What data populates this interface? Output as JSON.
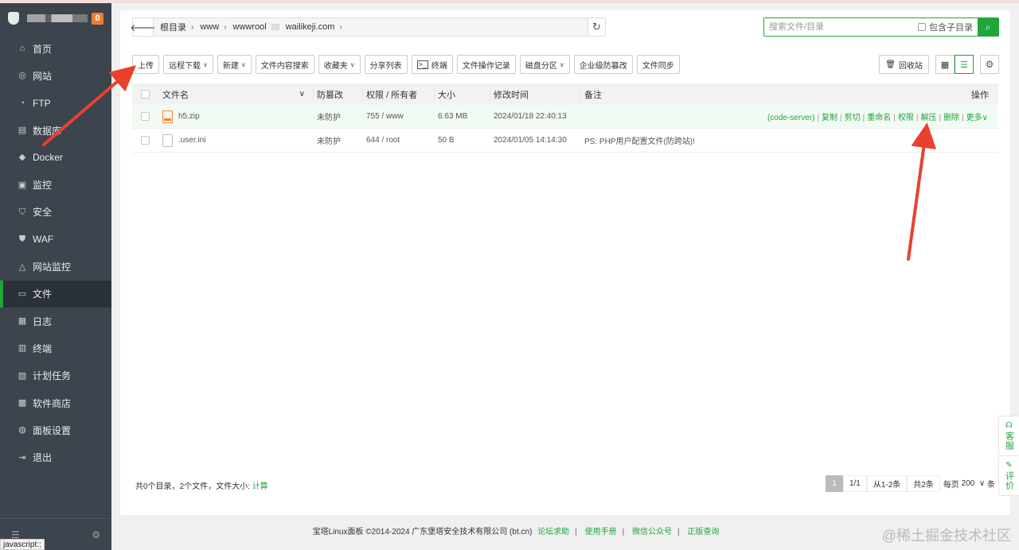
{
  "sidebar": {
    "badge": "0",
    "items": [
      {
        "label": "首页",
        "icon": "home-icon",
        "glyph": "⌂"
      },
      {
        "label": "网站",
        "icon": "globe-icon",
        "glyph": "◎"
      },
      {
        "label": "FTP",
        "icon": "ftp-icon",
        "glyph": "◔"
      },
      {
        "label": "数据库",
        "icon": "database-icon",
        "glyph": "▤"
      },
      {
        "label": "Docker",
        "icon": "docker-icon",
        "glyph": "◆"
      },
      {
        "label": "监控",
        "icon": "monitor-icon",
        "glyph": "▣"
      },
      {
        "label": "安全",
        "icon": "shield-icon",
        "glyph": "⛉"
      },
      {
        "label": "WAF",
        "icon": "waf-icon",
        "glyph": "⛊"
      },
      {
        "label": "网站监控",
        "icon": "chart-icon",
        "glyph": "△"
      },
      {
        "label": "文件",
        "icon": "folder-icon",
        "glyph": "▭"
      },
      {
        "label": "日志",
        "icon": "log-icon",
        "glyph": "▦"
      },
      {
        "label": "终端",
        "icon": "terminal-icon",
        "glyph": "▥"
      },
      {
        "label": "计划任务",
        "icon": "task-icon",
        "glyph": "▧"
      },
      {
        "label": "软件商店",
        "icon": "store-icon",
        "glyph": "▩"
      },
      {
        "label": "面板设置",
        "icon": "settings-icon",
        "glyph": "◍"
      },
      {
        "label": "退出",
        "icon": "logout-icon",
        "glyph": "⇥"
      }
    ],
    "active_index": 9,
    "status_tip": "javascript:;"
  },
  "path": {
    "crumbs": [
      "根目录",
      "www",
      "wwwrool",
      "wailikeji.com"
    ]
  },
  "search": {
    "placeholder": "搜索文件/目录",
    "include_sub": "包含子目录"
  },
  "toolbar": {
    "upload": "上传",
    "remote_download": "远程下载",
    "new": "新建",
    "content_search": "文件内容搜索",
    "favorites": "收藏夹",
    "share_list": "分享列表",
    "terminal": "终端",
    "op_log": "文件操作记录",
    "disk": "磁盘分区",
    "tamper": "企业级防篡改",
    "sync": "文件同步",
    "recycle": "回收站"
  },
  "table": {
    "headers": {
      "name": "文件名",
      "protect": "防篡改",
      "perm": "权限 / 所有者",
      "size": "大小",
      "mtime": "修改时间",
      "note": "备注",
      "ops": "操作"
    },
    "rows": [
      {
        "name": "h5.zip",
        "type": "zip",
        "protect": "未防护",
        "perm": "755 / www",
        "size": "6.63 MB",
        "mtime": "2024/01/18 22:40:13",
        "note": ""
      },
      {
        "name": ".user.ini",
        "type": "file",
        "protect": "未防护",
        "perm": "644 / root",
        "size": "50 B",
        "mtime": "2024/01/05 14:14:30",
        "note": "PS: PHP用户配置文件(防跨站)!"
      }
    ],
    "row_ops": {
      "code_server": "(code-server)",
      "copy": "复制",
      "cut": "剪切",
      "rename": "重命名",
      "perm": "权限",
      "unzip": "解压",
      "delete": "删除",
      "more": "更多"
    }
  },
  "summary": {
    "text": "共0个目录，2个文件，文件大小:",
    "calc": "计算"
  },
  "pager": {
    "current": "1",
    "pages": "1/1",
    "range": "从1-2条",
    "total": "共2条",
    "per_page_label": "每页",
    "per_page": "200",
    "unit": "条"
  },
  "footer": {
    "copyright": "宝塔Linux面板 ©2014-2024 广东堡塔安全技术有限公司 (bt.cn)",
    "forum": "论坛求助",
    "manual": "使用手册",
    "wechat": "微信公众号",
    "genuine": "正版查询"
  },
  "float": {
    "service": "客服",
    "review": "评价"
  },
  "watermark": "@稀土掘金技术社区",
  "colors": {
    "accent": "#20a53a",
    "sidebar": "#3c444d",
    "annotation": "#e8412e"
  }
}
